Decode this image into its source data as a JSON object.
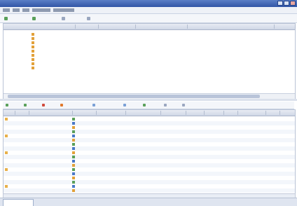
{
  "window": {
    "title": ""
  },
  "menus": [
    {
      "w": 0
    },
    {
      "w": 0
    },
    {
      "w": 0
    },
    {
      "w": 0
    },
    {
      "w": 0
    }
  ],
  "toolbar": {
    "buttons": [
      "",
      "",
      "",
      ""
    ],
    "right_text": ""
  },
  "top_table": {
    "headers": [
      "",
      "",
      "",
      "",
      "",
      ""
    ],
    "rows": [
      {
        "name": "",
        "v1": "",
        "v2": "",
        "v3": ""
      },
      {
        "name": "",
        "v1": "",
        "v2": "",
        "v3": ""
      },
      {
        "name": "",
        "v1": "",
        "v2": "",
        "v3": ""
      },
      {
        "name": "",
        "v1": "",
        "v2": "",
        "v3": ""
      },
      {
        "name": "",
        "v1": "",
        "v2": "",
        "v3": ""
      },
      {
        "name": "",
        "v1": "",
        "v2": "",
        "v3": ""
      },
      {
        "name": "",
        "v1": "",
        "v2": "",
        "v3": ""
      },
      {
        "name": "",
        "v1": "",
        "v2": "",
        "v3": ""
      },
      {
        "name": "",
        "v1": "",
        "v2": "",
        "v3": ""
      }
    ]
  },
  "toolbar2": {
    "buttons": [
      "",
      "",
      "",
      "",
      "",
      "",
      "",
      "",
      ""
    ]
  },
  "bottom_table": {
    "headers": [
      "",
      "",
      "",
      "",
      "",
      "",
      "",
      "",
      "",
      "",
      "",
      "",
      "",
      ""
    ],
    "rows": 18
  },
  "tabs": [
    "",
    "",
    "",
    "",
    "",
    "",
    "",
    "",
    ""
  ],
  "colors": {
    "title_bar": "#3155a6",
    "header_bg": "#d6dde9",
    "accent_green": "#5aa05a",
    "folder_orange": "#e2a13a",
    "link_blue": "#3b5cb5"
  }
}
